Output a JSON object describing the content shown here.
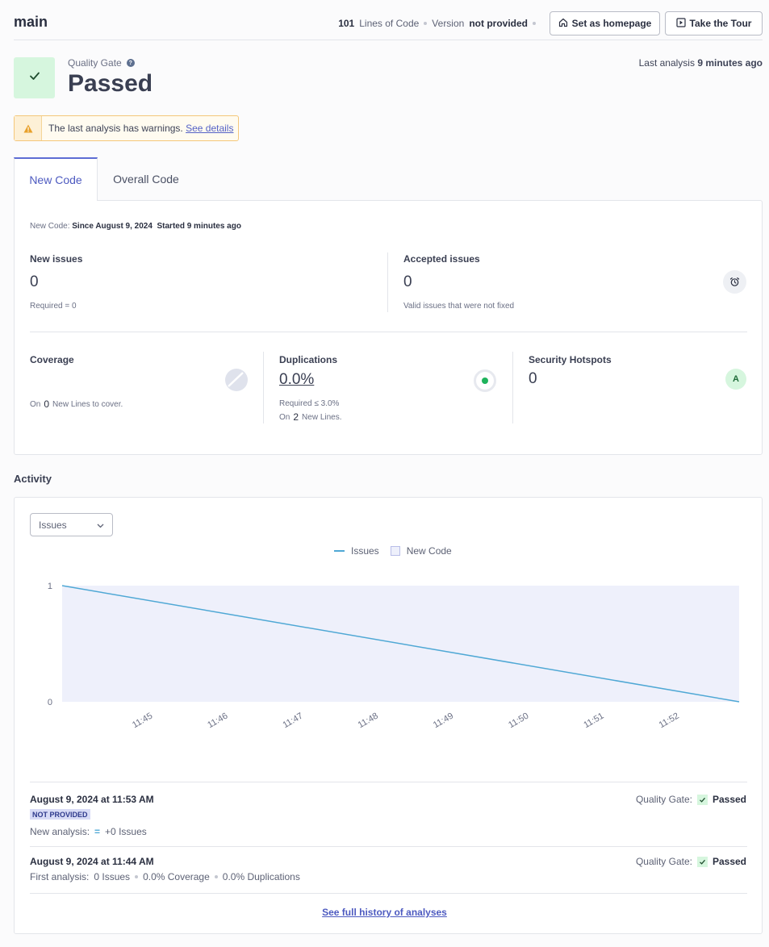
{
  "header": {
    "branch": "main",
    "loc_value": "101",
    "loc_label": "Lines of Code",
    "version_label": "Version",
    "version_value": "not provided",
    "home_button": "Set as homepage",
    "tour_button": "Take the Tour"
  },
  "quality_gate": {
    "label": "Quality Gate",
    "status": "Passed",
    "last_analysis_label": "Last analysis",
    "last_analysis_value": "9 minutes ago"
  },
  "warning": {
    "text": "The last analysis has warnings.",
    "link": "See details"
  },
  "tabs": [
    {
      "label": "New Code",
      "active": true
    },
    {
      "label": "Overall Code",
      "active": false
    }
  ],
  "new_code": {
    "prefix": "New Code:",
    "since": "Since August 9, 2024",
    "started": "Started 9 minutes ago"
  },
  "metrics": {
    "new_issues": {
      "label": "New issues",
      "value": "0",
      "sub": "Required = 0"
    },
    "accepted_issues": {
      "label": "Accepted issues",
      "value": "0",
      "sub": "Valid issues that were not fixed"
    },
    "coverage": {
      "label": "Coverage",
      "sub_prefix": "On",
      "sub_num": "0",
      "sub_suffix": "New Lines to cover."
    },
    "duplications": {
      "label": "Duplications",
      "value": "0.0%",
      "required": "Required ≤ 3.0%",
      "sub_prefix": "On",
      "sub_num": "2",
      "sub_suffix": "New Lines."
    },
    "hotspots": {
      "label": "Security Hotspots",
      "value": "0",
      "rating": "A"
    }
  },
  "activity": {
    "title": "Activity",
    "select_value": "Issues",
    "legend_issues": "Issues",
    "legend_newcode": "New Code",
    "history_link": "See full history of analyses",
    "analyses": [
      {
        "date": "August 9, 2024 at 11:53 AM",
        "gate_label": "Quality Gate:",
        "gate_value": "Passed",
        "badge": "NOT PROVIDED",
        "line_label": "New analysis:",
        "line_value": "+0 Issues"
      },
      {
        "date": "August 9, 2024 at 11:44 AM",
        "gate_label": "Quality Gate:",
        "gate_value": "Passed",
        "line_label": "First analysis:",
        "items": [
          "0 Issues",
          "0.0% Coverage",
          "0.0% Duplications"
        ]
      }
    ]
  },
  "colors": {
    "accent": "#5d6cd4",
    "success_bg": "#d6f6de",
    "warning_border": "#f4c77a",
    "issues_line": "#4fa8d5",
    "newcode_area": "#eef0fb"
  },
  "chart_data": {
    "type": "line",
    "x": [
      "11:45",
      "11:46",
      "11:47",
      "11:48",
      "11:49",
      "11:50",
      "11:51",
      "11:52"
    ],
    "series": [
      {
        "name": "Issues",
        "points": [
          [
            11.733,
            1
          ],
          [
            11.883,
            0
          ]
        ]
      }
    ],
    "new_code_area": [
      11.733,
      11.883
    ],
    "y_ticks": [
      "0",
      "1"
    ],
    "ylim": [
      0,
      1
    ],
    "xlim": [
      11.733,
      11.883
    ],
    "legend": "top-center"
  }
}
